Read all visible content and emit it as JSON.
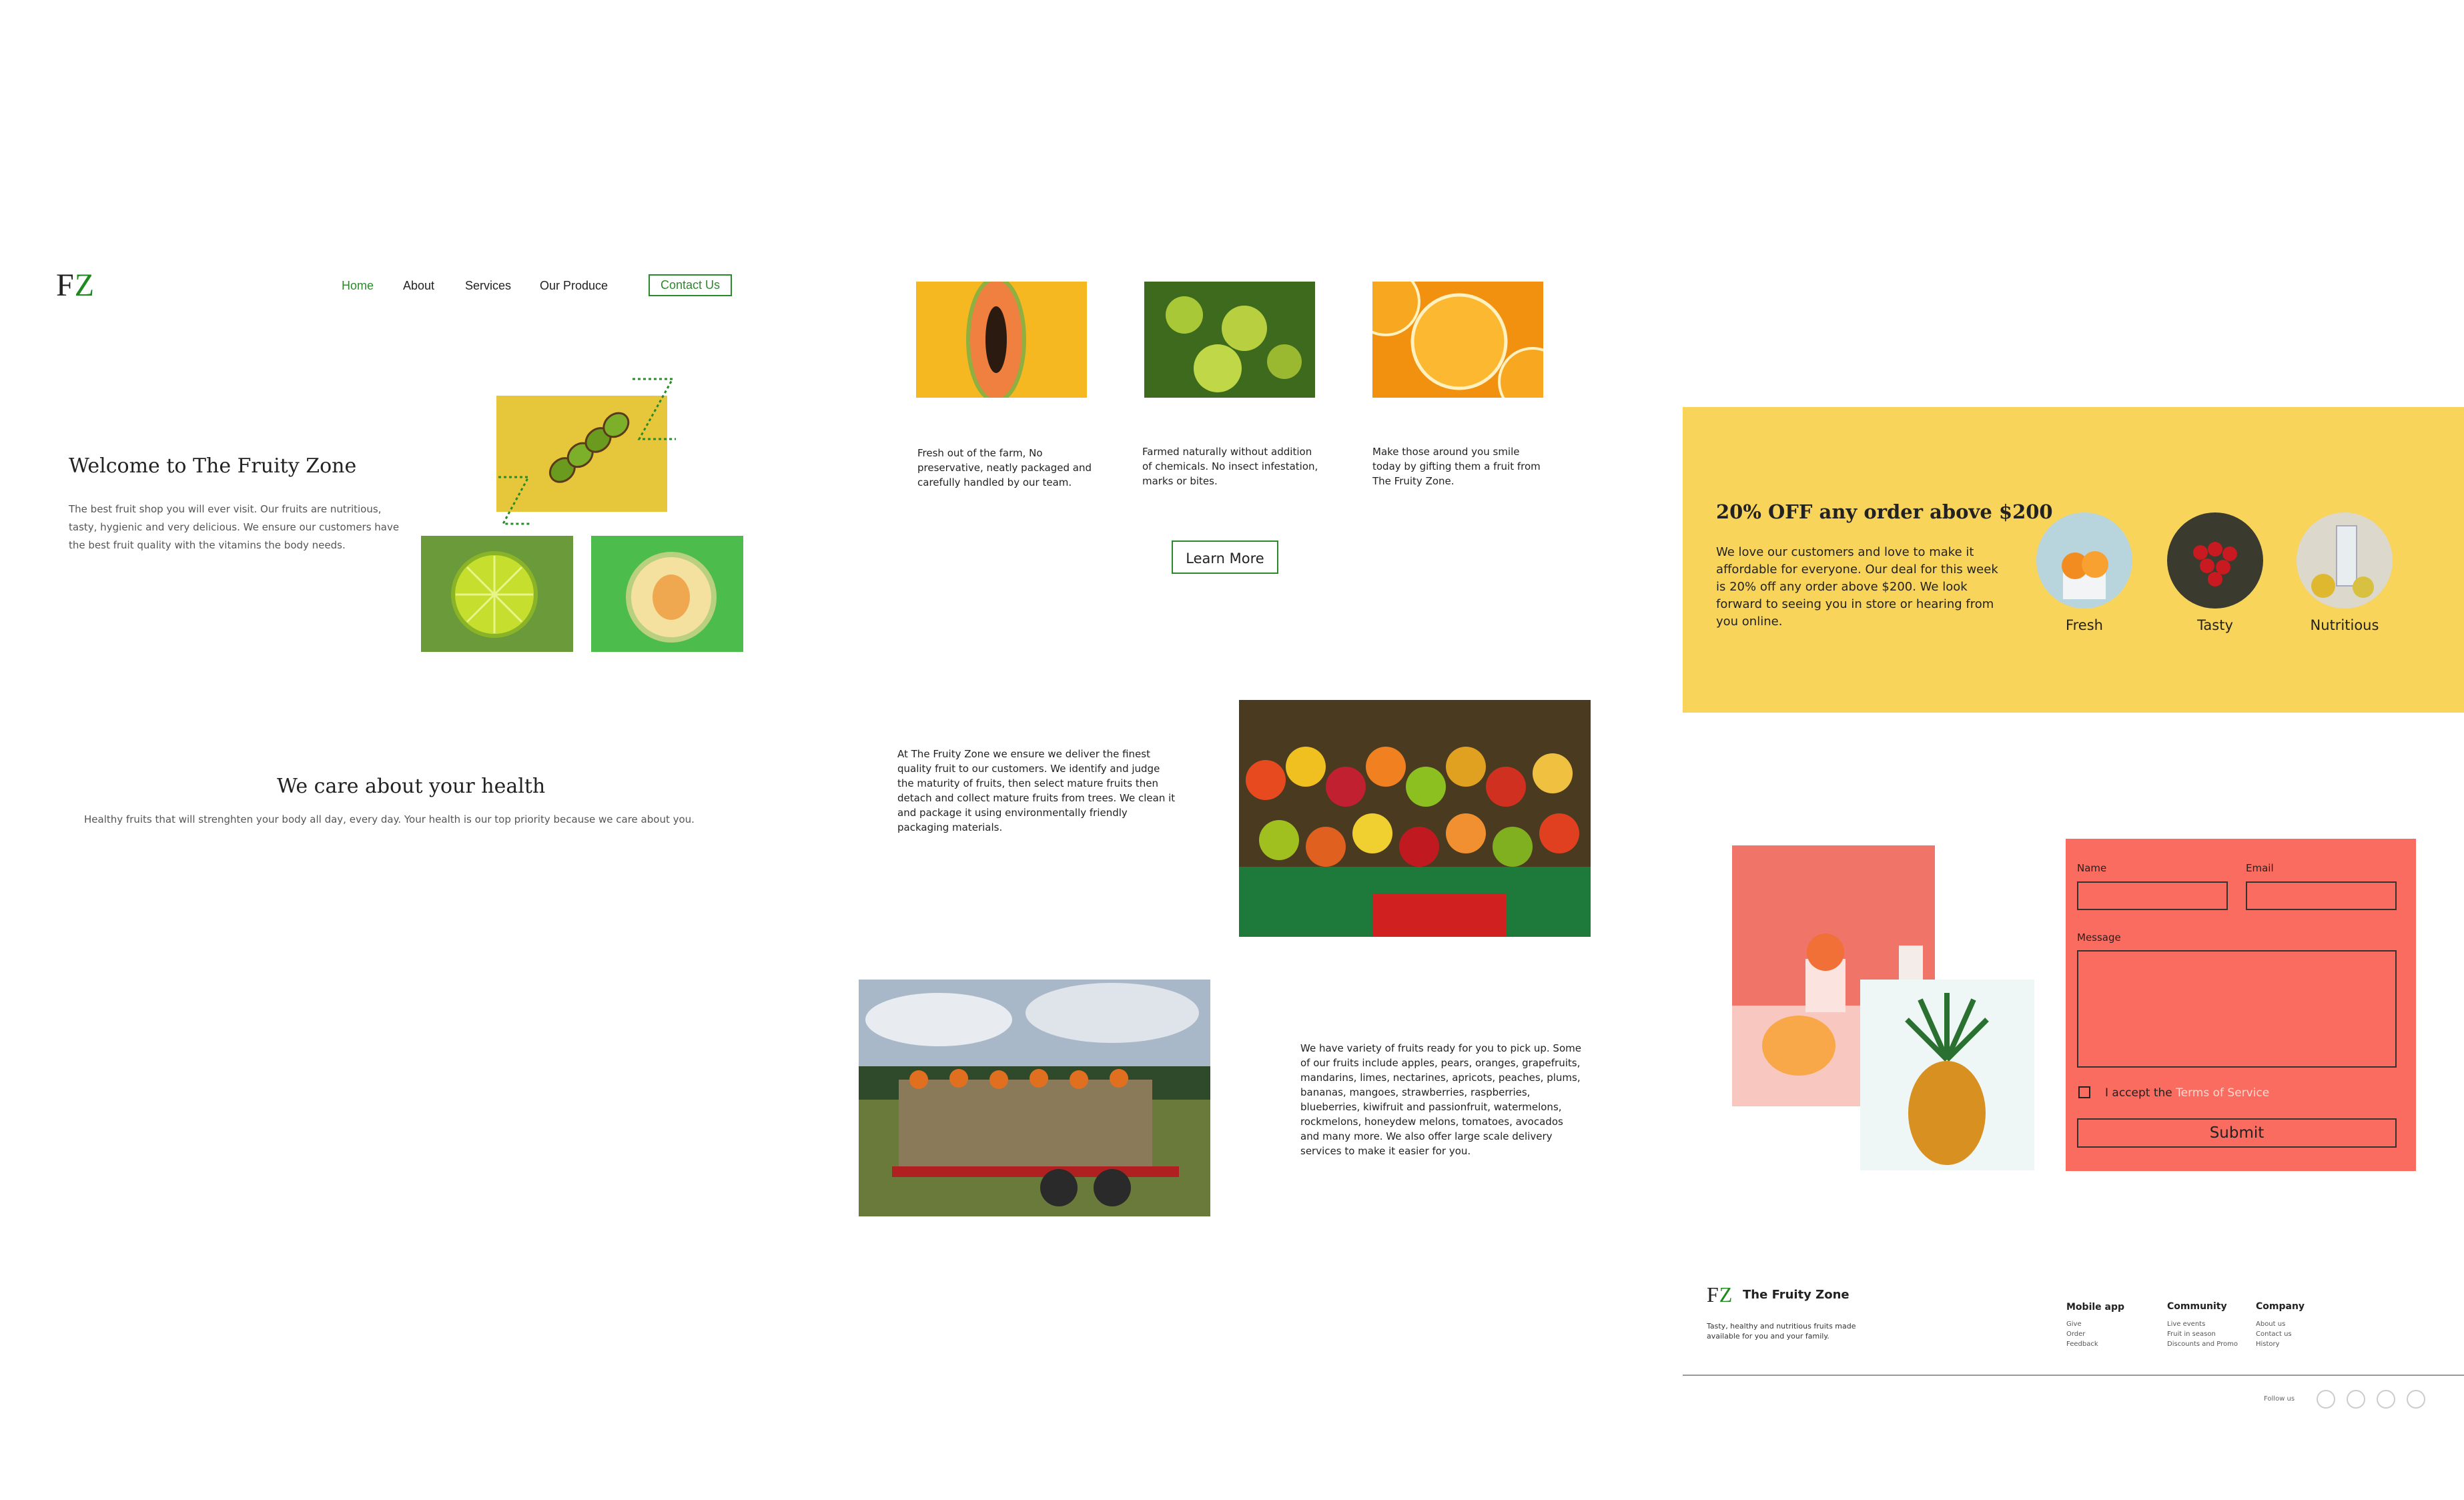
{
  "header": {
    "logo_f": "F",
    "logo_z": "Z",
    "nav": [
      "Home",
      "About",
      "Services",
      "Our Produce"
    ],
    "contact_label": "Contact Us"
  },
  "hero": {
    "title": "Welcome to The Fruity Zone",
    "text": "The best fruit shop you will ever visit. Our fruits are nutritious, tasty, hygienic and very delicious. We ensure our customers have the best fruit quality with the vitamins the body needs."
  },
  "care": {
    "title": "We care about your health",
    "text": "Healthy fruits that will strenghten your body all day, every day. Your health is our top priority because we care about you."
  },
  "features": [
    {
      "text": "Fresh out of the farm, No preservative, neatly packaged and carefully handled by our team."
    },
    {
      "text": "Farmed naturally without addition of chemicals. No insect infestation, marks or bites."
    },
    {
      "text": "Make those around you smile today by gifting them a fruit from The Fruity Zone."
    }
  ],
  "learn_more_label": "Learn More",
  "about_text": "At The Fruity Zone we ensure we deliver the finest quality fruit to our customers. We identify and judge the maturity of fruits, then select mature fruits then detach and collect mature fruits from trees. We clean it and package it using environmentally friendly packaging materials.",
  "variety_text": "We have variety of fruits ready for you to pick up. Some of our fruits include apples, pears, oranges, grapefruits, mandarins, limes, nectarines, apricots, peaches, plums, bananas, mangoes, strawberries, raspberries, blueberries, kiwifruit and passionfruit, watermelons, rockmelons, honeydew melons, tomatoes, avocados and many more. We also offer large scale delivery services to make it easier for you.",
  "promo": {
    "title": "20% OFF any order above $200",
    "text": "We love our customers and love to make it affordable for everyone. Our deal for this week is 20% off any order above $200. We look forward to seeing you in store or hearing from you online.",
    "circles": [
      "Fresh",
      "Tasty",
      "Nutritious"
    ]
  },
  "form": {
    "name_label": "Name",
    "email_label": "Email",
    "message_label": "Message",
    "accept_text": "I accept the ",
    "terms_link": "Terms of Service",
    "submit_label": "Submit"
  },
  "footer": {
    "brand": "The Fruity Zone",
    "tagline": "Tasty, healthy and nutritious fruits made available for you and your family.",
    "columns": [
      {
        "title": "Mobile app",
        "links": [
          "Give",
          "Order",
          "Feedback"
        ]
      },
      {
        "title": "Community",
        "links": [
          "Live events",
          "Fruit in season",
          "Discounts and Promo"
        ]
      },
      {
        "title": "Company",
        "links": [
          "About us",
          "Contact us",
          "History"
        ]
      }
    ],
    "follow_label": "Follow us"
  },
  "colors": {
    "brand_green": "#2a8a2a",
    "promo_yellow": "#f9d45b",
    "form_coral": "#fa6b60"
  }
}
